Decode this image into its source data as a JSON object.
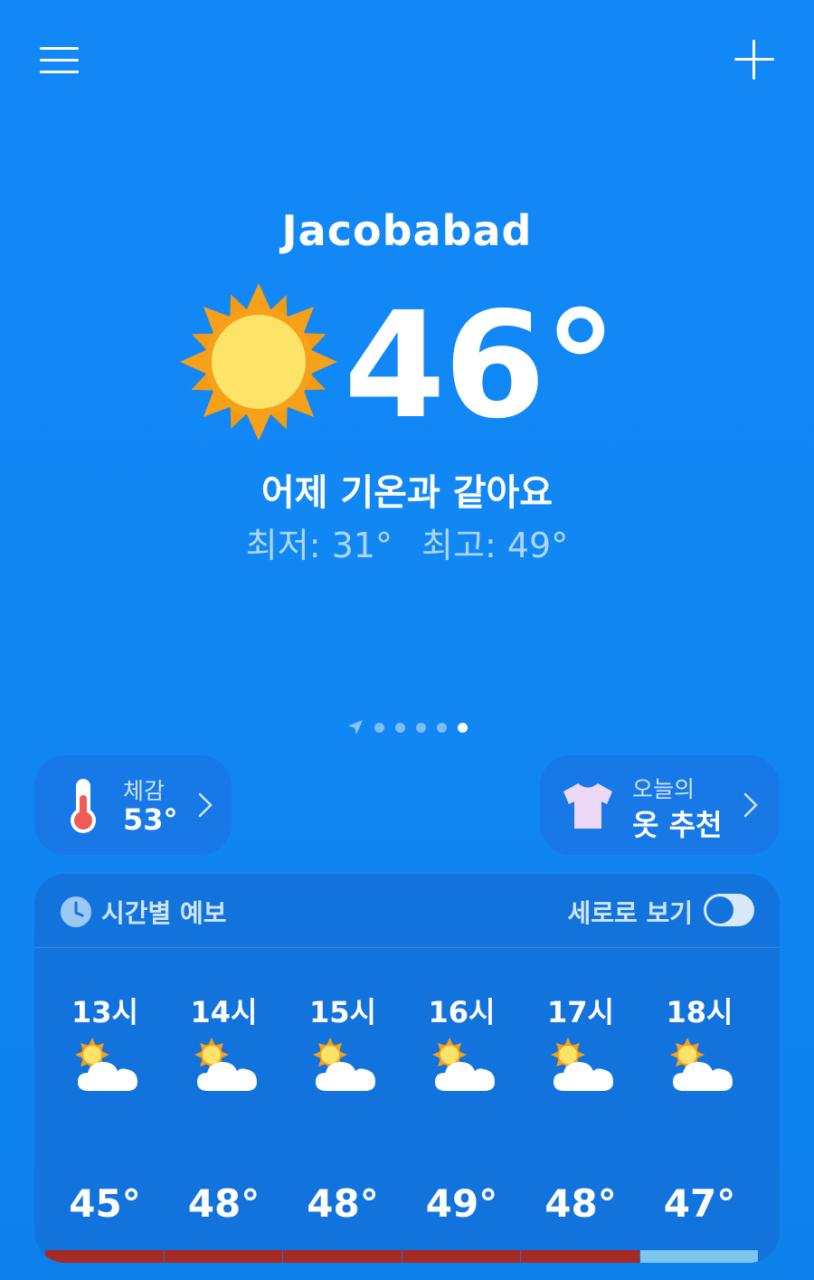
{
  "city": "Jacobabad",
  "current": {
    "temp": "46°",
    "comparison": "어제 기온과 같아요",
    "min_label": "최저: 31°",
    "max_label": "최고: 49°",
    "icon": "sun-icon"
  },
  "pager": {
    "total_dots": 5,
    "active_index": 4
  },
  "feels_like": {
    "label": "체감",
    "value": "53°"
  },
  "clothes": {
    "label": "오늘의",
    "value": "옷 추천"
  },
  "hourly": {
    "title": "시간별 예보",
    "vertical_label": "세로로 보기",
    "vertical_toggle_on": false,
    "items": [
      {
        "time": "13시",
        "temp": "45°",
        "icon": "partly-cloudy-icon"
      },
      {
        "time": "14시",
        "temp": "48°",
        "icon": "partly-cloudy-icon"
      },
      {
        "time": "15시",
        "temp": "48°",
        "icon": "partly-cloudy-icon"
      },
      {
        "time": "16시",
        "temp": "49°",
        "icon": "partly-cloudy-icon"
      },
      {
        "time": "17시",
        "temp": "48°",
        "icon": "partly-cloudy-icon"
      },
      {
        "time": "18시",
        "temp": "47°",
        "icon": "partly-cloudy-icon"
      }
    ],
    "bar_colors": [
      "#a62a22",
      "#a62a22",
      "#a62a22",
      "#a62a22",
      "#a62a22",
      "#7cc6ef"
    ]
  },
  "colors": {
    "background": "#1188f6",
    "sun_outer": "#f7a019",
    "sun_inner": "#fde468"
  }
}
